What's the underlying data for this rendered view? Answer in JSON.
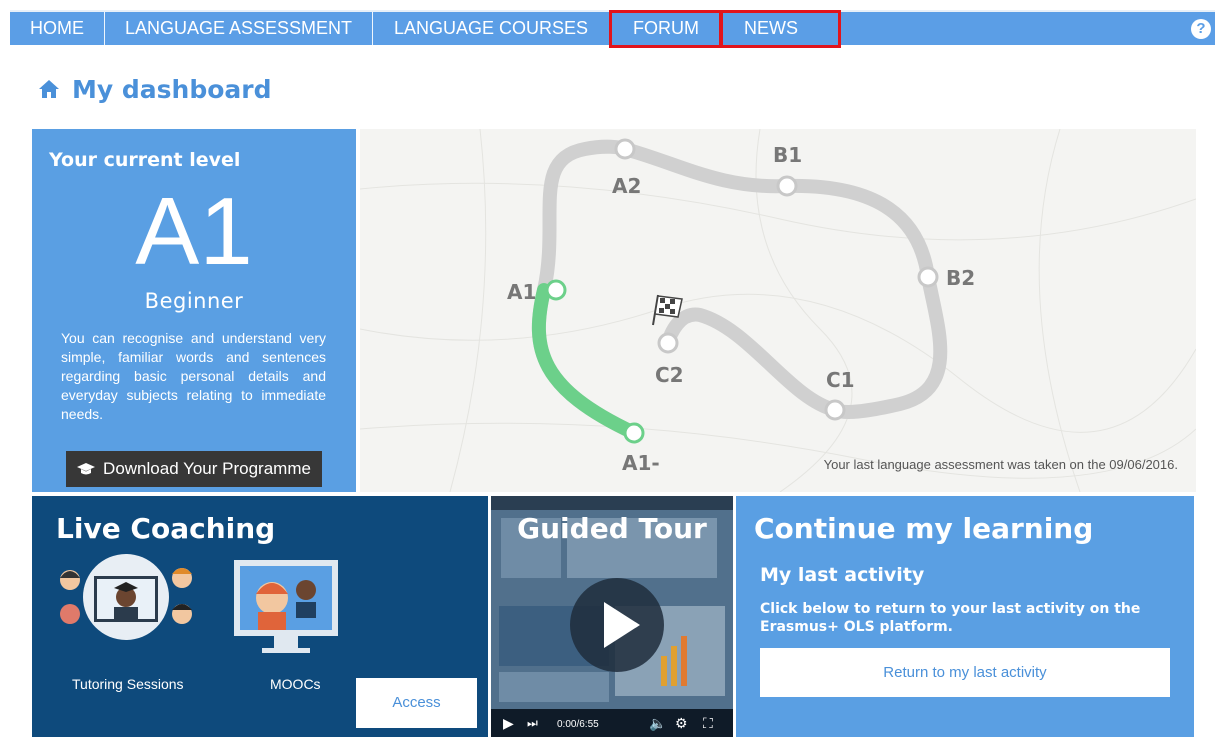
{
  "nav": {
    "items": [
      {
        "label": "HOME"
      },
      {
        "label": "LANGUAGE ASSESSMENT"
      },
      {
        "label": "LANGUAGE COURSES"
      },
      {
        "label": "FORUM"
      },
      {
        "label": "NEWS"
      }
    ],
    "help_glyph": "?"
  },
  "page": {
    "title": "My dashboard",
    "title_icon": "home-icon"
  },
  "level": {
    "label": "Your current level",
    "code": "A1",
    "name": "Beginner",
    "description": "You can recognise and understand very simple, familiar words and sentences regarding basic personal details and everyday subjects relating to immediate needs.",
    "download_label": "Download Your Programme",
    "download_icon": "graduation-cap-icon"
  },
  "map": {
    "levels": [
      "A1-",
      "A1",
      "A2",
      "B1",
      "B2",
      "C1",
      "C2"
    ],
    "current_level": "A1",
    "last_assessment": "Your last language assessment was taken on the 09/06/2016.",
    "colors": {
      "completed": "#6cd08a",
      "track": "#d0d0d0"
    }
  },
  "coaching": {
    "title": "Live Coaching",
    "tutoring_label": "Tutoring Sessions",
    "moocs_label": "MOOCs",
    "access_label": "Access"
  },
  "tour": {
    "title": "Guided Tour",
    "time": "0:00/6:55"
  },
  "continue": {
    "title": "Continue my learning",
    "subtitle": "My last activity",
    "text": "Click below to return to your last activity on the Erasmus+ OLS platform.",
    "button_label": "Return to my last activity"
  },
  "colors": {
    "nav": "#5b9ee6",
    "panel": "#5a9fe3",
    "dark_panel": "#0e4a7c",
    "highlight": "#e2141c"
  }
}
